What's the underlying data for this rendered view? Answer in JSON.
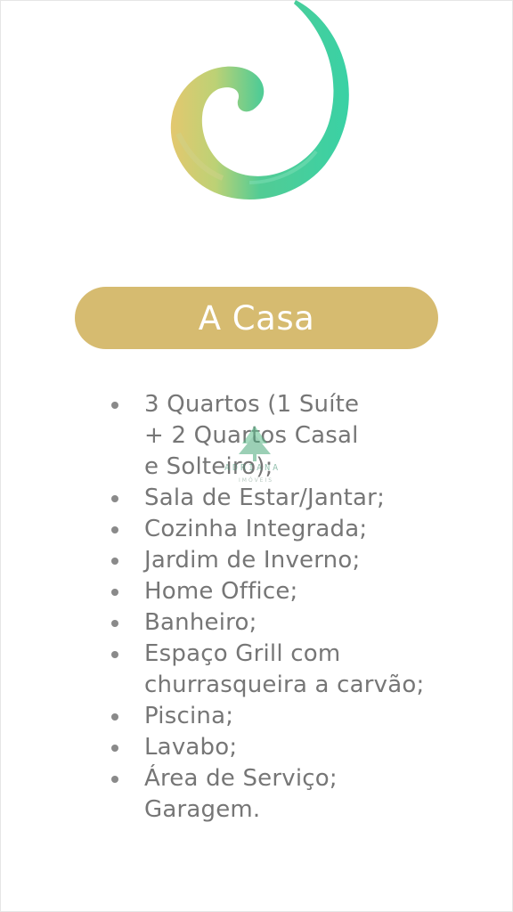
{
  "colors": {
    "pill_background": "#d6bb70",
    "pill_text": "#ffffff",
    "body_text": "#767676",
    "swirl_green": "#3ccf9a",
    "swirl_gold": "#d9c46a"
  },
  "header": {
    "title": "A Casa"
  },
  "watermark": {
    "name": "ADRIANA",
    "subtitle": "IMÓVEIS",
    "icon": "tree-logo-icon"
  },
  "features": [
    {
      "text": "3 Quartos (1 Suíte\n+ 2 Quartos Casal\ne Solteiro);"
    },
    {
      "text": "Sala de Estar/Jantar;"
    },
    {
      "text": "Cozinha Integrada;"
    },
    {
      "text": "Jardim de Inverno;"
    },
    {
      "text": "Home Office;"
    },
    {
      "text": "Banheiro;"
    },
    {
      "text": "Espaço Grill com\nchurrasqueira a carvão;"
    },
    {
      "text": "Piscina;"
    },
    {
      "text": "Lavabo;"
    },
    {
      "text": "Área de Serviço;\nGaragem."
    }
  ]
}
